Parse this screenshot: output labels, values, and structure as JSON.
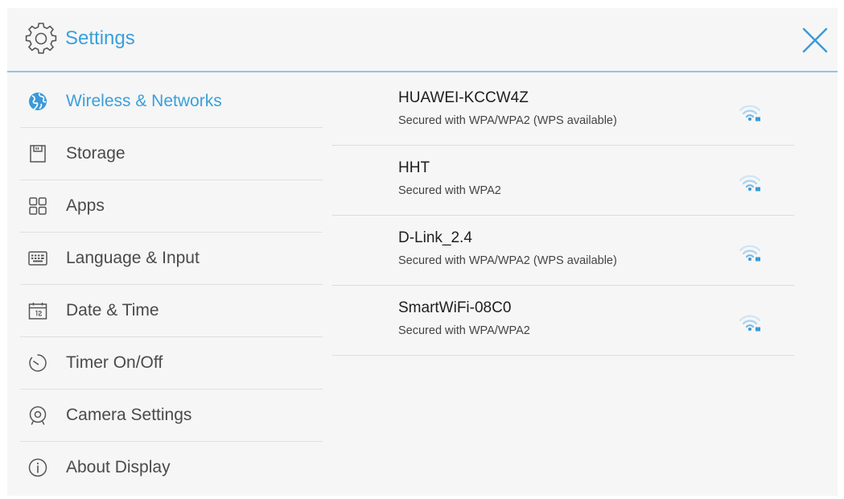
{
  "header": {
    "title": "Settings",
    "settings_icon": "gear-icon",
    "close_icon": "close-icon"
  },
  "colors": {
    "accent": "#39a0dc",
    "header_rule": "#8fc3e6",
    "panel_background": "#f6f6f6",
    "wifi_icon": "#8ec4ea"
  },
  "sidebar": {
    "items": [
      {
        "label": "Wireless & Networks",
        "icon": "globe-icon",
        "active": true
      },
      {
        "label": "Storage",
        "icon": "sd-card-icon",
        "active": false
      },
      {
        "label": "Apps",
        "icon": "apps-grid-icon",
        "active": false
      },
      {
        "label": "Language & Input",
        "icon": "keyboard-icon",
        "active": false
      },
      {
        "label": "Date & Time",
        "icon": "calendar-icon",
        "active": false
      },
      {
        "label": "Timer On/Off",
        "icon": "timer-icon",
        "active": false
      },
      {
        "label": "Camera Settings",
        "icon": "camera-icon",
        "active": false
      },
      {
        "label": "About Display",
        "icon": "info-icon",
        "active": false
      }
    ]
  },
  "networks": [
    {
      "ssid": "HUAWEI-KCCW4Z",
      "security": "Secured with WPA/WPA2 (WPS available)",
      "icon": "wifi-secured-icon"
    },
    {
      "ssid": "HHT",
      "security": "Secured with WPA2",
      "icon": "wifi-secured-icon"
    },
    {
      "ssid": "D-Link_2.4",
      "security": "Secured with WPA/WPA2 (WPS available)",
      "icon": "wifi-secured-icon"
    },
    {
      "ssid": "SmartWiFi-08C0",
      "security": "Secured with WPA/WPA2",
      "icon": "wifi-secured-icon"
    }
  ]
}
